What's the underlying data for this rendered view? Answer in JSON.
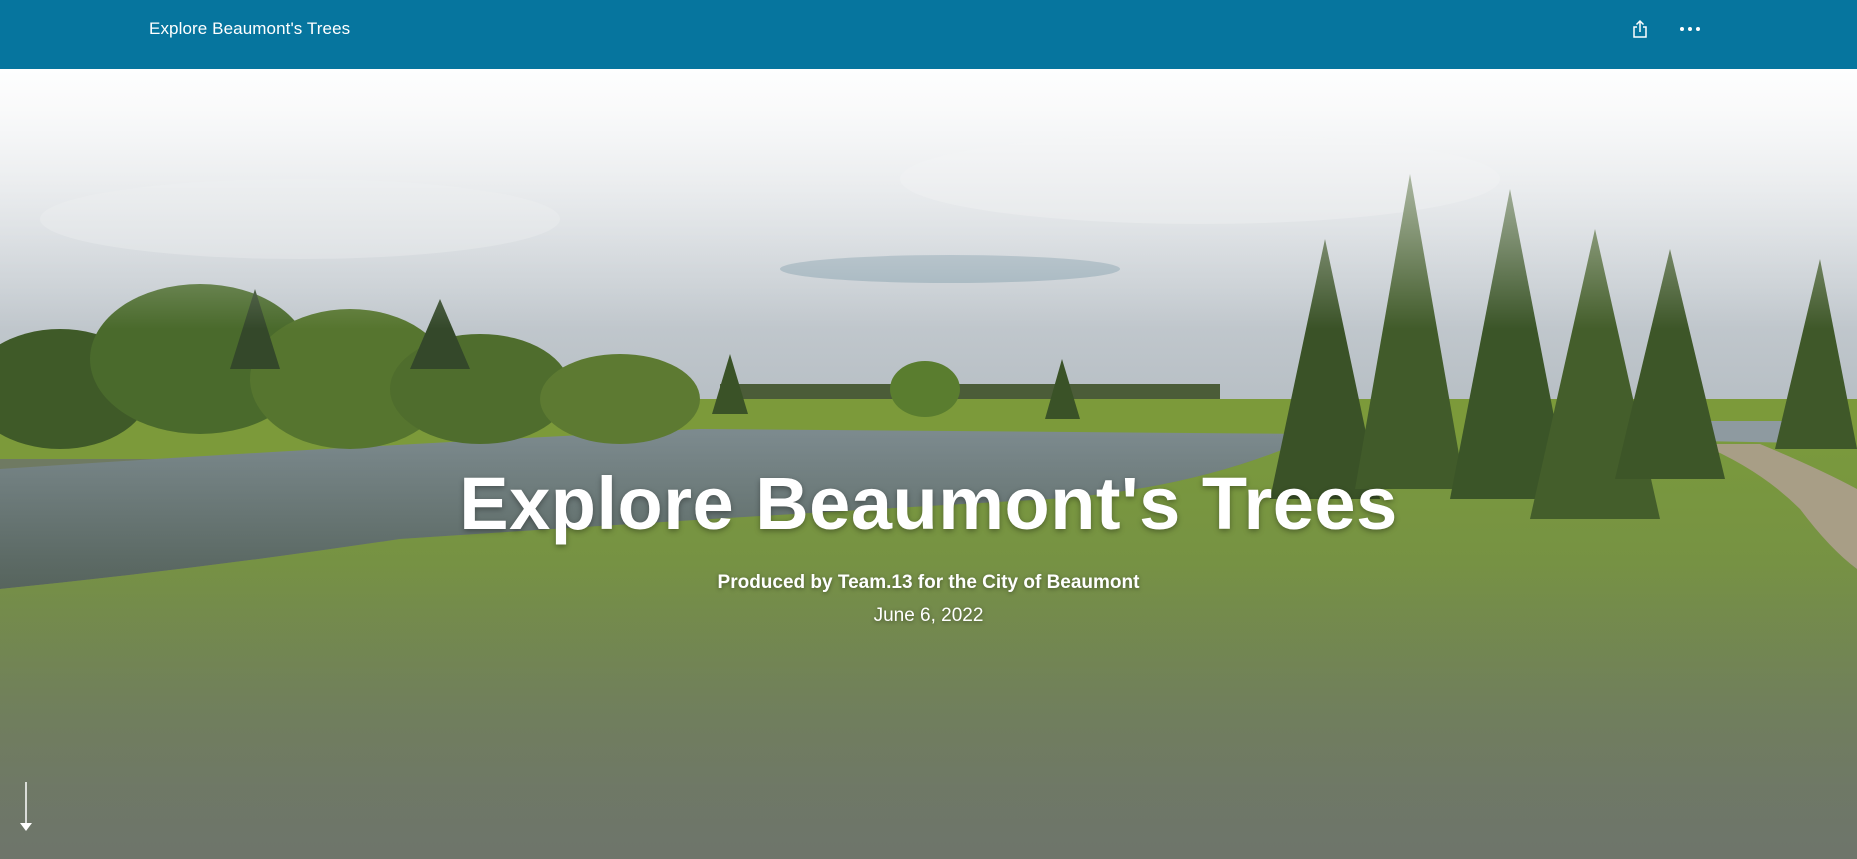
{
  "header": {
    "title": "Explore Beaumont's Trees",
    "share_icon": "share-icon",
    "more_icon": "more-options-icon",
    "background_color": "#06759e"
  },
  "hero": {
    "title": "Explore Beaumont's Trees",
    "subtitle": "Produced by Team.13 for the City of Beaumont",
    "date": "June 6, 2022",
    "scroll_icon": "arrow-down-icon"
  }
}
